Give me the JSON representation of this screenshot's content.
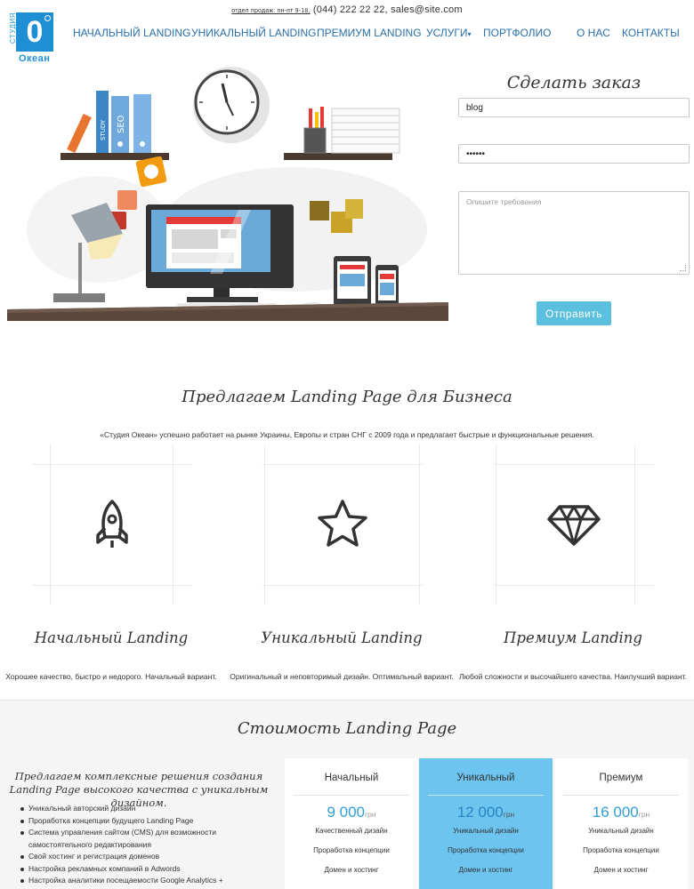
{
  "header": {
    "contact_small": "отдел продаж: пн-пт 9-18,",
    "phone": "(044) 222 22 22,",
    "email": "sales@site.com",
    "logo": {
      "vertical": "СТУДИЯ",
      "mark": "0",
      "word": "Океан"
    },
    "nav": [
      "НАЧАЛЬНЫЙ LANDING",
      "УНИКАЛЬНЫЙ LANDING",
      "ПРЕМИУМ LANDING",
      "УСЛУГИ",
      "ПОРТФОЛИО",
      "О НАС",
      "КОНТАКТЫ"
    ]
  },
  "hero_art": {
    "books": [
      "STUDY",
      "SEO"
    ]
  },
  "order_form": {
    "title": "Сделать заказ",
    "name_value": "blog",
    "password_value": "••••••",
    "requirements_placeholder": "Опишите требования",
    "submit_label": "Отправить"
  },
  "offer": {
    "title": "Предлагаем Landing Page для Бизнеса",
    "description": "«Студия Океан» успешно работает на рынке Украины, Европы и стран СНГ с 2009 года и предлагает быстрые и функциональные решения.",
    "cards": [
      {
        "icon": "rocket-icon",
        "title": "Начальный Landing",
        "text": "Хорошее качество, быстро и недорого. Начальный вариант."
      },
      {
        "icon": "star-icon",
        "title": "Уникальный Landing",
        "text": "Оригинальный и неповторимый дизайн. Оптимальный вариант."
      },
      {
        "icon": "diamond-icon",
        "title": "Премиум Landing",
        "text": "Любой сложности и высочайшего качества. Наилучший вариант."
      }
    ]
  },
  "pricing": {
    "title": "Стоимость Landing Page",
    "intro": "Предлагаем комплексные решения создания Landing Page высокого качества с уникальным дизайном.",
    "features": [
      "Уникальный авторский дизайн",
      "Проработка концепции будущего Landing Page",
      "Система управления сайтом (CMS) для возможности самостоятельного редактирования",
      "Свой хостинг и регистрация доменов",
      "Настройка рекламных компаний в Adwords",
      "Настройка аналитики посещаемости Google Analytics +"
    ],
    "plans": [
      {
        "name": "Начальный",
        "price": "9 000",
        "currency": "грн",
        "features": [
          "Качественный дизайн",
          "Проработка концепции",
          "Домен и хостинг"
        ]
      },
      {
        "name": "Уникальный",
        "price": "12 000",
        "currency": "грн",
        "features": [
          "Уникальный дизайн",
          "Проработка концепции",
          "Домен и хостинг"
        ]
      },
      {
        "name": "Премиум",
        "price": "16 000",
        "currency": "грн",
        "features": [
          "Уникальный дизайн",
          "Проработка концепции",
          "Домен и хостинг"
        ]
      }
    ]
  },
  "colors": {
    "brand": "#1e8fd4",
    "nav": "#2a6fa8",
    "button": "#5bc0de",
    "plan_highlight": "#6cc4ef",
    "price": "#2f9fd8"
  }
}
